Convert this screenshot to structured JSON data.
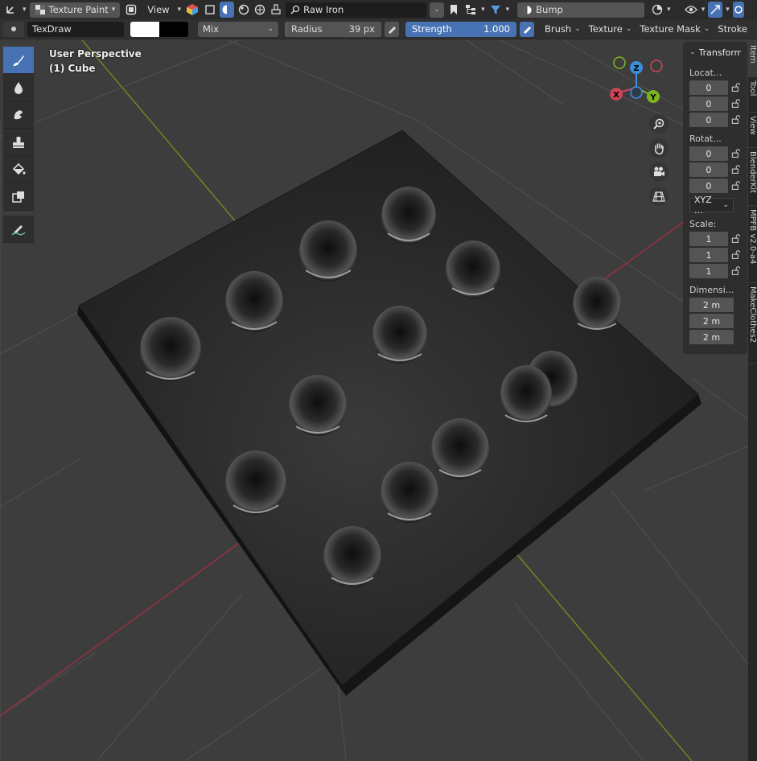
{
  "header": {
    "mode_label": "Texture Paint",
    "view_label": "View",
    "material_search": "Raw Iron",
    "bump_label": "Bump"
  },
  "toolsettings": {
    "brush_name": "TexDraw",
    "blend_mode": "Mix",
    "radius_label": "Radius",
    "radius_value": "39 px",
    "strength_label": "Strength",
    "strength_value": "1.000",
    "brush_menu": "Brush",
    "texture_menu": "Texture",
    "texture_mask_menu": "Texture Mask",
    "stroke_menu": "Stroke"
  },
  "viewport": {
    "perspective": "User Perspective",
    "object": "(1) Cube"
  },
  "gizmo": {
    "x": "X",
    "y": "Y",
    "z": "Z"
  },
  "npanel": {
    "title": "Transform",
    "location_label": "Locat...",
    "location": [
      "0",
      "0",
      "0"
    ],
    "rotation_label": "Rotat...",
    "rotation": [
      "0",
      "0",
      "0"
    ],
    "rotation_mode": "XYZ ...",
    "scale_label": "Scale:",
    "scale": [
      "1",
      "1",
      "1"
    ],
    "dimensions_label": "Dimensi...",
    "dimensions": [
      "2 m",
      "2 m",
      "2 m"
    ]
  },
  "sidetabs": [
    "Item",
    "Tool",
    "View",
    "BlenderKit",
    "MPFB v2.0-a4",
    "MakeClothes2"
  ],
  "tools": [
    "draw-tool",
    "soften-tool",
    "smear-tool",
    "clone-tool",
    "fill-tool",
    "mask-tool",
    "annotate-tool"
  ],
  "colors": {
    "accent": "#4772b3",
    "x_axis": "#c94456",
    "y_axis": "#7fb31e",
    "z_axis": "#3b8ede",
    "grid_x": "#9b3040",
    "grid_y": "#6a8a1c"
  }
}
